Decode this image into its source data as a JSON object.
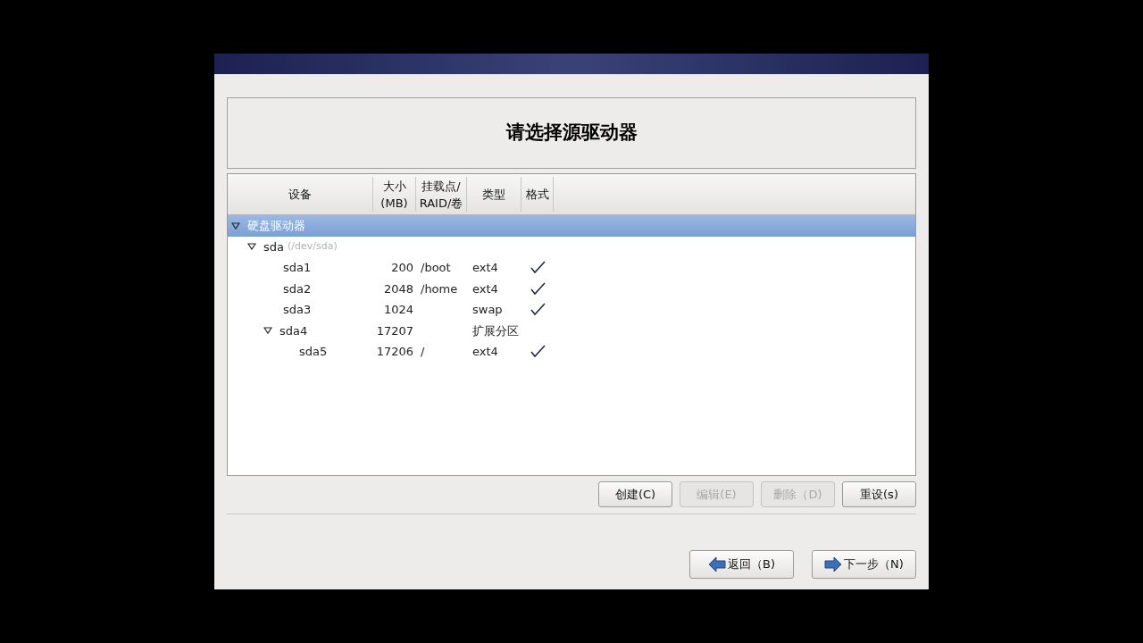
{
  "title": "请选择源驱动器",
  "table": {
    "columns": [
      "设备",
      "大小\n(MB)",
      "挂载点/\nRAID/卷",
      "类型",
      "格式"
    ],
    "rows": [
      {
        "name": "硬盘驱动器",
        "selected": true,
        "expanded": true,
        "children": [
          {
            "name": "sda",
            "path": "(/dev/sda)",
            "selected": false,
            "expanded": true,
            "children": [
              {
                "name": "sda1",
                "size": "200",
                "mount": "/boot",
                "type": "ext4",
                "format": true,
                "selected": false
              },
              {
                "name": "sda2",
                "size": "2048",
                "mount": "/home",
                "type": "ext4",
                "format": true,
                "selected": false
              },
              {
                "name": "sda3",
                "size": "1024",
                "type": "swap",
                "format": true,
                "selected": false
              },
              {
                "name": "sda4",
                "size": "17207",
                "type": "扩展分区",
                "format": false,
                "selected": false,
                "expanded": true,
                "children": [
                  {
                    "name": "sda5",
                    "size": "17206",
                    "mount": "/",
                    "type": "ext4",
                    "format": true,
                    "selected": false
                  }
                ]
              }
            ]
          }
        ]
      }
    ]
  },
  "actions": [
    {
      "label": "创建(C)",
      "disabled": false
    },
    {
      "label": "编辑(E)",
      "disabled": true
    },
    {
      "label": "删除（D)",
      "disabled": true
    },
    {
      "label": "重设(s)",
      "disabled": false
    }
  ],
  "nav": [
    {
      "label": "返回（B)",
      "kind": "back"
    },
    {
      "label": "下一步（N)",
      "kind": "next"
    }
  ]
}
